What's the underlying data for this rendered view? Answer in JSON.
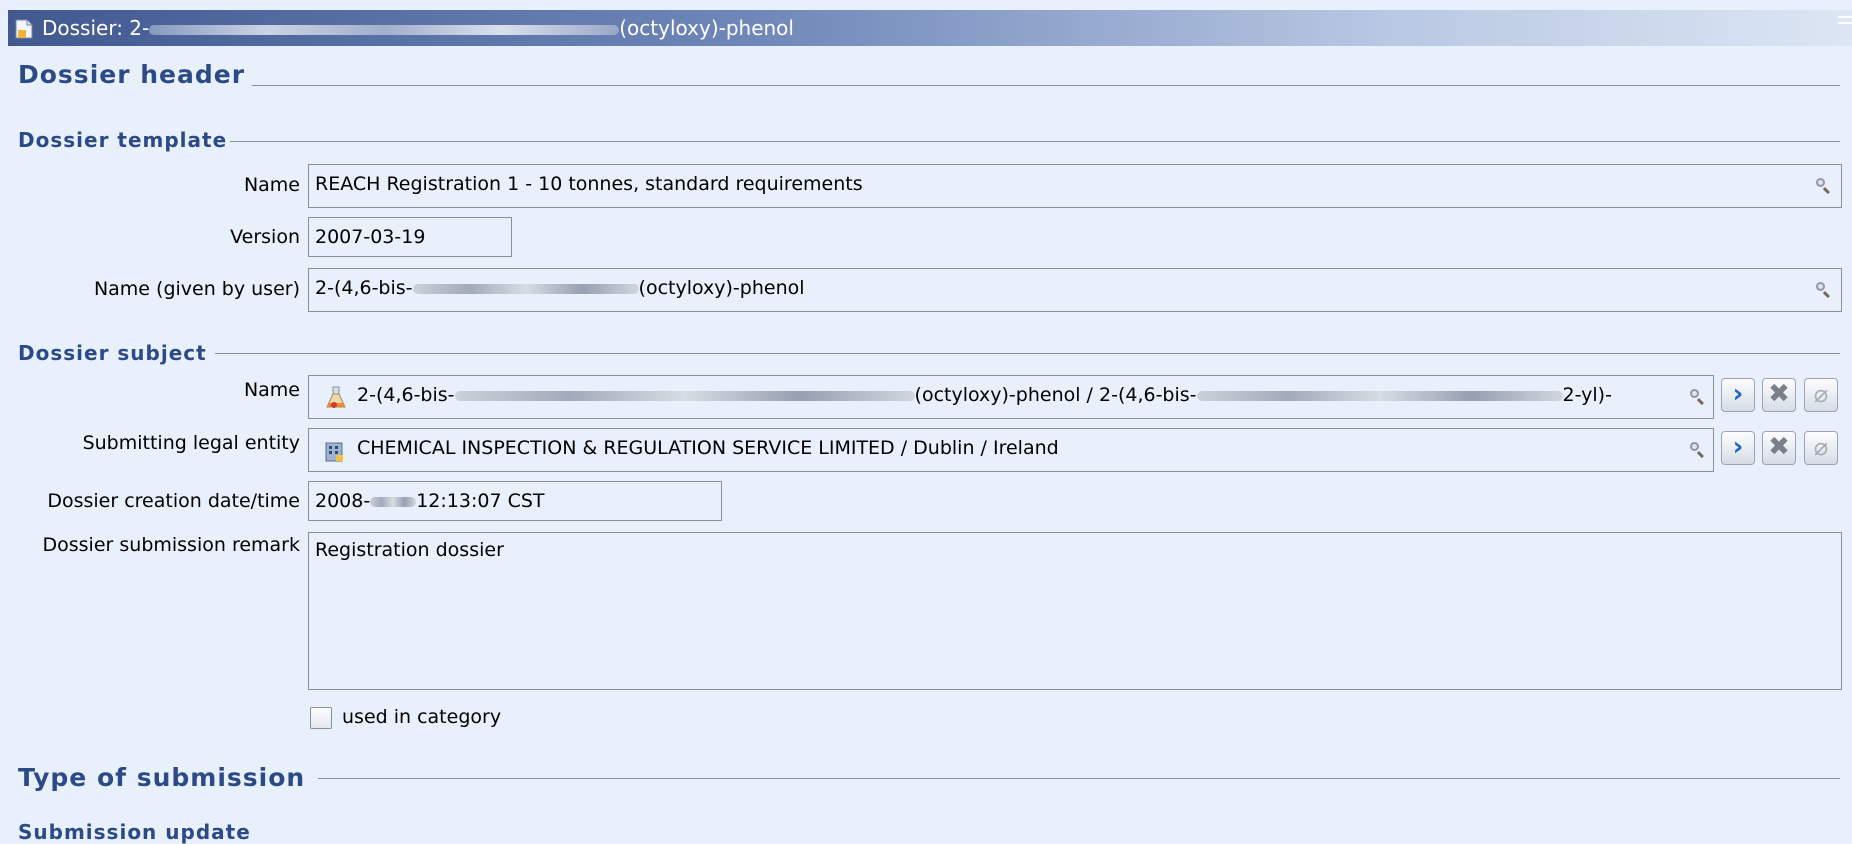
{
  "window": {
    "title_prefix": "Dossier: 2-",
    "title_suffix": "(octyloxy)-phenol",
    "icon": "dossier-icon"
  },
  "sections": {
    "dossier_header": "Dossier header",
    "dossier_template": "Dossier template",
    "dossier_subject": "Dossier subject",
    "type_of_submission": "Type of submission",
    "submission_update": "Submission update"
  },
  "template": {
    "name_label": "Name",
    "name_value": "REACH Registration 1 - 10 tonnes, standard requirements",
    "version_label": "Version",
    "version_value": "2007-03-19",
    "user_name_label": "Name (given by user)",
    "user_name_prefix": "2-(4,6-bis-",
    "user_name_suffix": "(octyloxy)-phenol"
  },
  "subject": {
    "name_label": "Name",
    "name_part1": "2-(4,6-bis-",
    "name_part2": "(octyloxy)-phenol / 2-(4,6-bis-",
    "name_part3": "2-yl)-",
    "entity_label": "Submitting legal entity",
    "entity_value": "CHEMICAL INSPECTION & REGULATION SERVICE LIMITED / Dublin / Ireland",
    "creation_label": "Dossier creation date/time",
    "creation_prefix": "2008-",
    "creation_suffix": "12:13:07 CST",
    "remark_label": "Dossier submission remark",
    "remark_value": "Registration dossier",
    "used_in_category_label": "used in category",
    "used_in_category_checked": false
  },
  "icons": {
    "search": "search-icon",
    "goto": "chevron-right-icon",
    "remove": "close-icon",
    "attach": "paperclip-icon",
    "substance": "flask-icon",
    "entity": "building-icon"
  },
  "colors": {
    "section_heading": "#2b4a87",
    "background": "#e8f0fb",
    "title_bar": "#41598f",
    "goto_arrow": "#1d62c9"
  }
}
